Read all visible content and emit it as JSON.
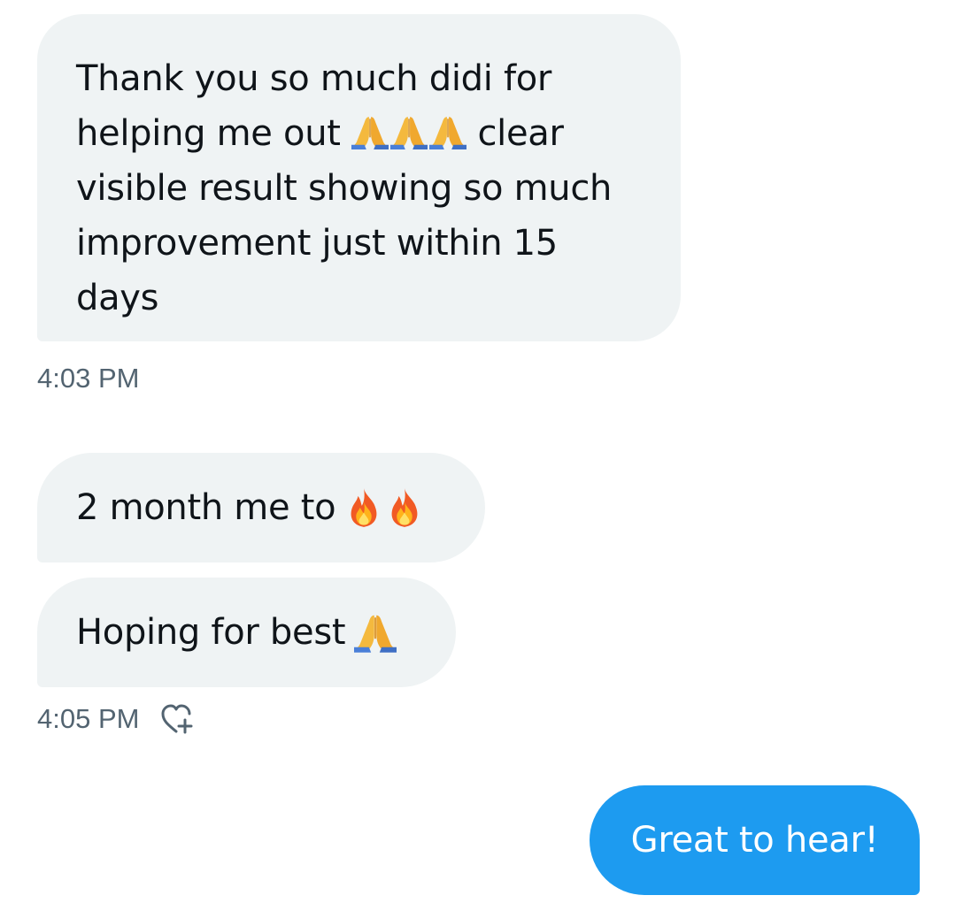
{
  "messages": [
    {
      "direction": "received",
      "lines": [
        "Thank you so much didi  for",
        "helping me out",
        "clear",
        "visible result showing so much",
        "improvement just within 15",
        "days"
      ],
      "emojis": [
        "folded-hands-icon",
        "folded-hands-icon",
        "folded-hands-icon"
      ]
    },
    {
      "direction": "received",
      "text": "2 month me to",
      "emojis": [
        "fire-icon",
        "fire-icon"
      ]
    },
    {
      "direction": "received",
      "text": "Hoping for best",
      "emojis": [
        "folded-hands-icon"
      ]
    },
    {
      "direction": "sent",
      "text": "Great to hear!"
    }
  ],
  "timestamps": {
    "group1": "4:03 PM",
    "group2": "4:05 PM"
  },
  "icons": {
    "reaction": "add-reaction-heart-icon"
  },
  "colors": {
    "received_bubble": "#eff3f4",
    "sent_bubble": "#1d9bf0",
    "timestamp": "#536471",
    "text": "#0f1419"
  }
}
